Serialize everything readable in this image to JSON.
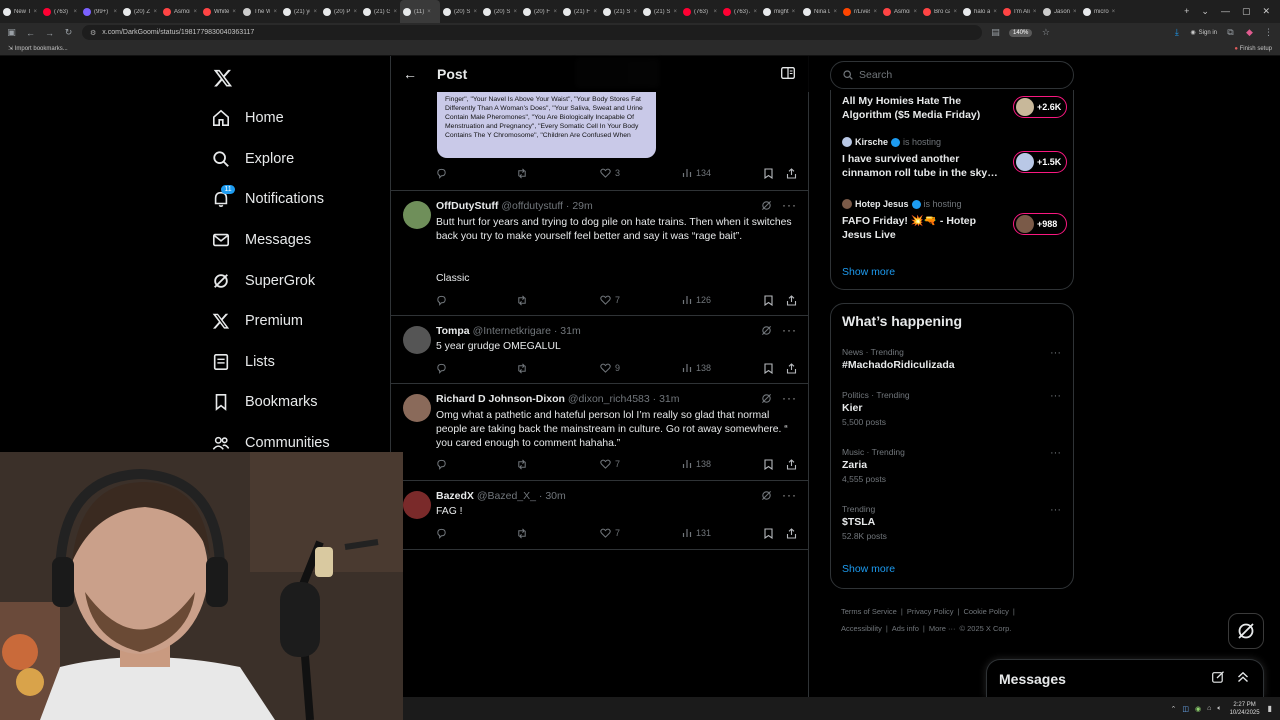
{
  "browser": {
    "tabs": [
      {
        "title": "New Ta",
        "color": "#e8eaed"
      },
      {
        "title": "(763) Y",
        "color": "#ff0033"
      },
      {
        "title": "(99+) a",
        "color": "#7b61ff"
      },
      {
        "title": "(20) Za",
        "color": "#e7e9ea"
      },
      {
        "title": "Asmon",
        "color": "#ff4444"
      },
      {
        "title": "White",
        "color": "#ff4444"
      },
      {
        "title": "The W",
        "color": "#cccccc"
      },
      {
        "title": "(21) ye",
        "color": "#e7e9ea"
      },
      {
        "title": "(20) Po",
        "color": "#e7e9ea"
      },
      {
        "title": "(21) Gi",
        "color": "#e7e9ea"
      },
      {
        "title": "(11)",
        "color": "#e7e9ea",
        "active": true
      },
      {
        "title": "(20) Sy",
        "color": "#e7e9ea"
      },
      {
        "title": "(20) Sy",
        "color": "#e7e9ea"
      },
      {
        "title": "(20) Fr",
        "color": "#e7e9ea"
      },
      {
        "title": "(21) Fr",
        "color": "#e7e9ea"
      },
      {
        "title": "(21) Sy",
        "color": "#e7e9ea"
      },
      {
        "title": "(21) Sy",
        "color": "#e7e9ea"
      },
      {
        "title": "(763) Y",
        "color": "#ff0033"
      },
      {
        "title": "(763) A",
        "color": "#ff0033"
      },
      {
        "title": "might",
        "color": "#e8eaed"
      },
      {
        "title": "Nina Li",
        "color": "#e8eaed"
      },
      {
        "title": "r/Lives",
        "color": "#ff4500"
      },
      {
        "title": "Asmon",
        "color": "#ff4444"
      },
      {
        "title": "Bro cal",
        "color": "#ff4444"
      },
      {
        "title": "halo a",
        "color": "#e8eaed"
      },
      {
        "title": "I'm Ali",
        "color": "#ff4444"
      },
      {
        "title": "Jason",
        "color": "#cccccc"
      },
      {
        "title": "micro",
        "color": "#e8eaed"
      }
    ],
    "url": "x.com/DarkGoomi/status/1981779830040363117",
    "zoom": "140%",
    "sign_in": "Sign in",
    "import_bookmarks": "Import bookmarks...",
    "finish_setup": "Finish setup"
  },
  "nav": {
    "items": [
      {
        "label": "Home",
        "icon": "home-icon"
      },
      {
        "label": "Explore",
        "icon": "search-icon"
      },
      {
        "label": "Notifications",
        "icon": "bell-icon",
        "badge": "11"
      },
      {
        "label": "Messages",
        "icon": "mail-icon"
      },
      {
        "label": "SuperGrok",
        "icon": "grok-icon"
      },
      {
        "label": "Premium",
        "icon": "x-logo-icon"
      },
      {
        "label": "Lists",
        "icon": "list-icon"
      },
      {
        "label": "Bookmarks",
        "icon": "bookmark-icon"
      },
      {
        "label": "Communities",
        "icon": "communities-icon"
      }
    ]
  },
  "main": {
    "header_title": "Post",
    "quoted_image_text": "Finger\", \"Your Navel Is Above Your Waist\", \"Your Body Stores Fat Differently Than A Woman's Does\", \"Your Saliva, Sweat and Urine Contain Male Pheromones\", \"You Are Biologically Incapable Of Menstruation and Pregnancy\", \"Every Somatic Cell In Your Body Contains The Y Chromosome\", \"Children Are Confused When",
    "first_actions": {
      "likes": "3",
      "views": "134"
    },
    "replies": [
      {
        "name": "OffDutyStuff",
        "handle": "@offdutystuff",
        "time": "· 29m",
        "text": "Butt hurt for years and trying to dog pile on hate trains.  Then when it switches back you try to make yourself feel better and say it was “rage bait”.",
        "text2": "Classic",
        "likes": "7",
        "views": "126",
        "avatar_color": "#6f8f5a"
      },
      {
        "name": "Tompa",
        "handle": "@Internetkrigare",
        "time": "· 31m",
        "text": "5 year grudge OMEGALUL",
        "likes": "9",
        "views": "138",
        "avatar_color": "#555555"
      },
      {
        "name": "Richard D Johnson-Dixon",
        "handle": "@dixon_rich4583",
        "time": "· 31m",
        "text": "Omg what a pathetic and hateful person lol I’m really so glad that normal people are taking back the mainstream in culture. Go rot away somewhere. “ you cared enough to comment hahaha.”",
        "likes": "7",
        "views": "138",
        "avatar_color": "#8a6a5a"
      },
      {
        "name": "BazedX",
        "handle": "@Bazed_X_",
        "time": "· 30m",
        "text": "FAG !",
        "likes": "7",
        "views": "131",
        "avatar_color": "#7a2a2a"
      }
    ]
  },
  "sidebar": {
    "search_placeholder": "Search",
    "spaces": [
      {
        "host": "",
        "hosting": "",
        "title": "All My Homies Hate The Algorithm ($5 Media Friday)",
        "count": "+2.6K",
        "face": "#c8b89a"
      },
      {
        "host": "Kirsche",
        "hosting": "is hosting",
        "title": "I have survived another cinnamon roll tube in the sky…",
        "count": "+1.5K",
        "face": "#b9c8e6"
      },
      {
        "host": "Hotep Jesus",
        "hosting": "is hosting",
        "title": "FAFO Friday! 💥🔫 - Hotep Jesus Live",
        "count": "+988",
        "face": "#7a5a48"
      }
    ],
    "show_more": "Show more",
    "happening_title": "What’s happening",
    "trends": [
      {
        "category": "News · Trending",
        "name": "#MachadoRidiculizada",
        "posts": ""
      },
      {
        "category": "Politics · Trending",
        "name": "Kier",
        "posts": "5,500 posts"
      },
      {
        "category": "Music · Trending",
        "name": "Zaria",
        "posts": "4,555 posts"
      },
      {
        "category": "Trending",
        "name": "$TSLA",
        "posts": "52.8K posts"
      }
    ],
    "show_more_2": "Show more",
    "footer": [
      "Terms of Service",
      "|",
      "Privacy Policy",
      "|",
      "Cookie Policy",
      "|",
      "Accessibility",
      "|",
      "Ads info",
      "|",
      "More ···",
      "© 2025 X Corp."
    ]
  },
  "messages_drawer": {
    "title": "Messages"
  },
  "taskbar": {
    "time": "2:27 PM",
    "date": "10/24/2025"
  },
  "colors": {
    "accent": "#1d9bf0",
    "live": "#f91880",
    "border": "#2f3336",
    "muted": "#71767b"
  }
}
